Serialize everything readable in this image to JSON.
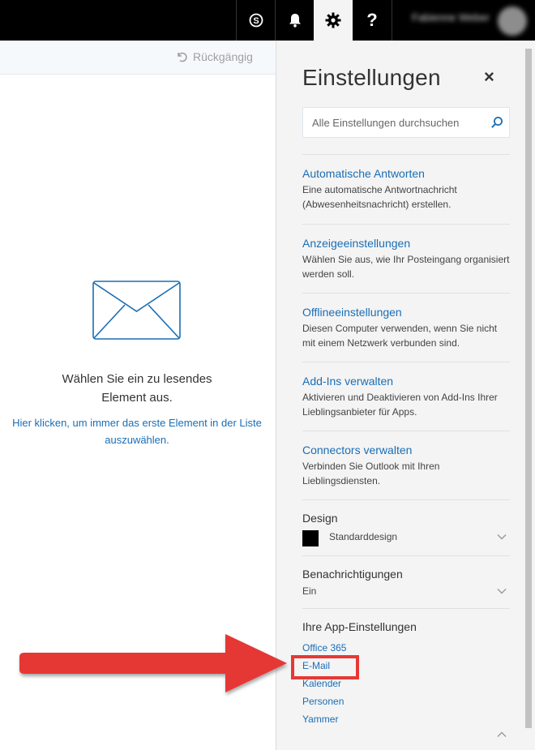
{
  "topbar": {
    "skype_icon": "skype-icon",
    "bell_icon": "bell-icon",
    "gear_icon": "gear-icon",
    "help_label": "?",
    "user_name": "Fabienne Weber"
  },
  "left_pane": {
    "undo_label": "Rückgängig",
    "empty_title": "Wählen Sie ein zu lesendes Element aus.",
    "empty_link": "Hier klicken, um immer das erste Element in der Liste auszuwählen."
  },
  "settings": {
    "title": "Einstellungen",
    "close_label": "×",
    "search_placeholder": "Alle Einstellungen durchsuchen",
    "items": [
      {
        "title": "Automatische Antworten",
        "desc": "Eine automatische Antwortnachricht (Abwesenheitsnachricht) erstellen."
      },
      {
        "title": "Anzeigeeinstellungen",
        "desc": "Wählen Sie aus, wie Ihr Posteingang organisiert werden soll."
      },
      {
        "title": "Offlineeinstellungen",
        "desc": "Diesen Computer verwenden, wenn Sie nicht mit einem Netzwerk verbunden sind."
      },
      {
        "title": "Add-Ins verwalten",
        "desc": "Aktivieren und Deaktivieren von Add-Ins Ihrer Lieblingsanbieter für Apps."
      },
      {
        "title": "Connectors verwalten",
        "desc": "Verbinden Sie Outlook mit Ihren Lieblingsdiensten."
      }
    ],
    "design": {
      "label": "Design",
      "value": "Standarddesign",
      "swatch_color": "#000000"
    },
    "notifications": {
      "label": "Benachrichtigungen",
      "value": "Ein"
    },
    "app_settings": {
      "label": "Ihre App-Einstellungen",
      "links": [
        "Office 365",
        "E-Mail",
        "Kalender",
        "Personen",
        "Yammer"
      ]
    }
  },
  "annotation": {
    "color": "#e53935",
    "target": "E-Mail"
  }
}
